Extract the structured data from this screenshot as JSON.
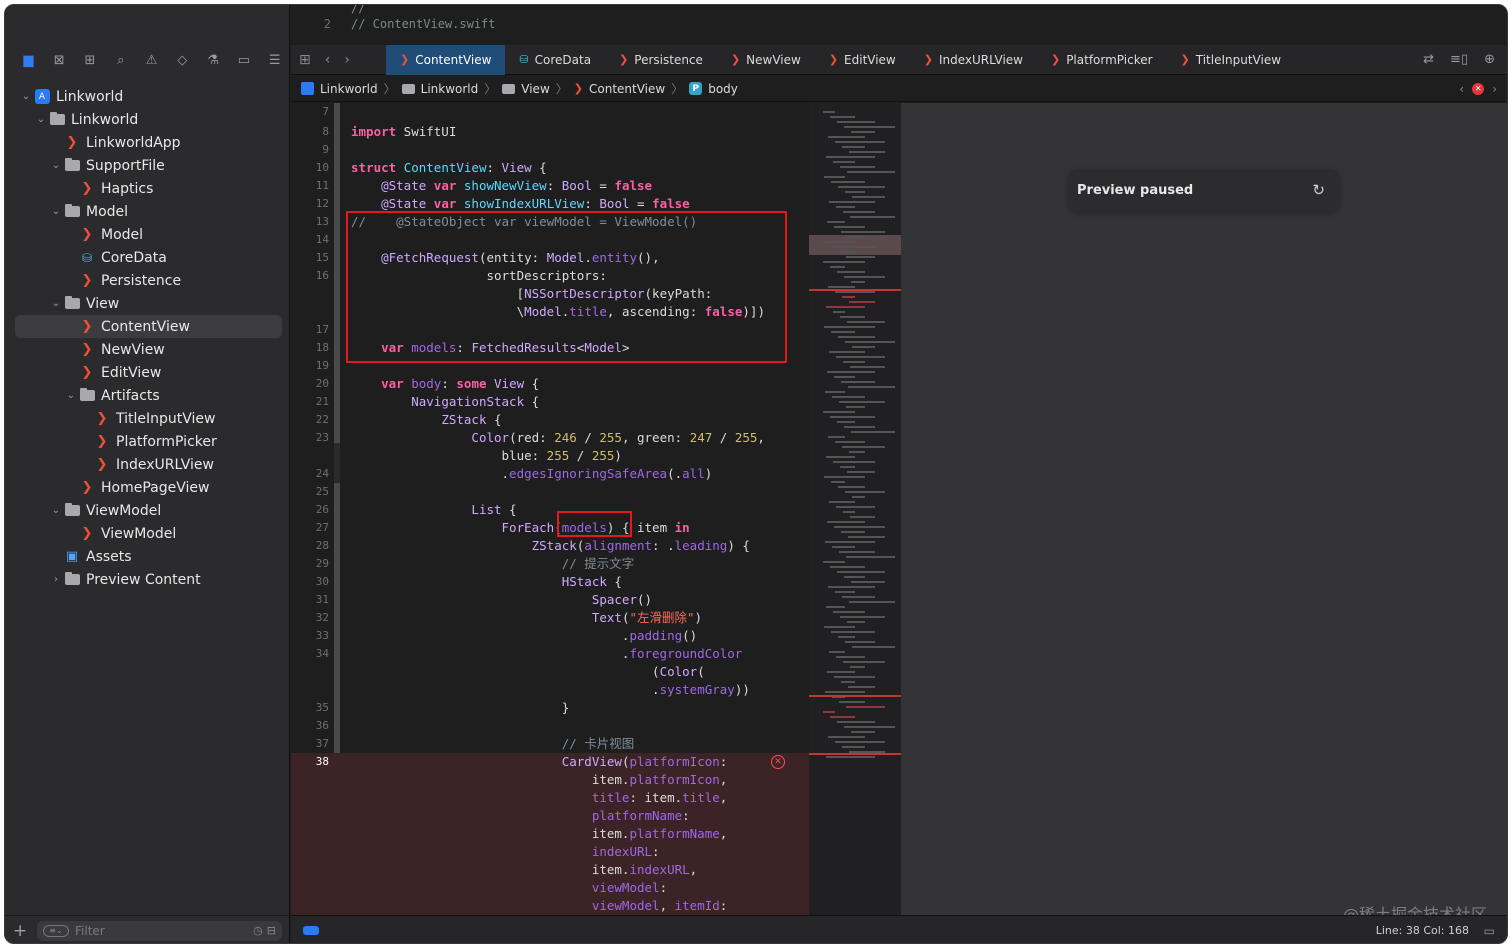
{
  "editor_top": {
    "lines": [
      {
        "n": "",
        "text": "//"
      },
      {
        "n": "2",
        "text": "//  ContentView.swift"
      }
    ]
  },
  "navigator": {
    "toolbar_icons": [
      "folder-icon",
      "x-square-icon",
      "hierarchy-icon",
      "search-icon",
      "warning-icon",
      "diamond-icon",
      "spray-icon",
      "tag-icon",
      "report-icon"
    ],
    "tree": [
      {
        "label": "Linkworld",
        "icon": "project-icon",
        "indent": 0,
        "chevron": "open"
      },
      {
        "label": "Linkworld",
        "icon": "folder-icon",
        "indent": 1,
        "chevron": "open"
      },
      {
        "label": "LinkworldApp",
        "icon": "swift-icon",
        "indent": 2,
        "chevron": ""
      },
      {
        "label": "SupportFile",
        "icon": "folder-icon",
        "indent": 2,
        "chevron": "open"
      },
      {
        "label": "Haptics",
        "icon": "swift-icon",
        "indent": 3,
        "chevron": ""
      },
      {
        "label": "Model",
        "icon": "folder-icon",
        "indent": 2,
        "chevron": "open"
      },
      {
        "label": "Model",
        "icon": "swift-icon",
        "indent": 3,
        "chevron": ""
      },
      {
        "label": "CoreData",
        "icon": "coredata-icon",
        "indent": 3,
        "chevron": ""
      },
      {
        "label": "Persistence",
        "icon": "swift-icon",
        "indent": 3,
        "chevron": ""
      },
      {
        "label": "View",
        "icon": "folder-icon",
        "indent": 2,
        "chevron": "open"
      },
      {
        "label": "ContentView",
        "icon": "swift-icon",
        "indent": 3,
        "chevron": "",
        "selected": true
      },
      {
        "label": "NewView",
        "icon": "swift-icon",
        "indent": 3,
        "chevron": ""
      },
      {
        "label": "EditView",
        "icon": "swift-icon",
        "indent": 3,
        "chevron": ""
      },
      {
        "label": "Artifacts",
        "icon": "folder-icon",
        "indent": 3,
        "chevron": "open"
      },
      {
        "label": "TitleInputView",
        "icon": "swift-icon",
        "indent": 4,
        "chevron": ""
      },
      {
        "label": "PlatformPicker",
        "icon": "swift-icon",
        "indent": 4,
        "chevron": ""
      },
      {
        "label": "IndexURLView",
        "icon": "swift-icon",
        "indent": 4,
        "chevron": ""
      },
      {
        "label": "HomePageView",
        "icon": "swift-icon",
        "indent": 3,
        "chevron": ""
      },
      {
        "label": "ViewModel",
        "icon": "folder-icon",
        "indent": 2,
        "chevron": "open"
      },
      {
        "label": "ViewModel",
        "icon": "swift-icon",
        "indent": 3,
        "chevron": ""
      },
      {
        "label": "Assets",
        "icon": "assets-icon",
        "indent": 2,
        "chevron": ""
      },
      {
        "label": "Preview Content",
        "icon": "folder-icon",
        "indent": 2,
        "chevron": "closed"
      }
    ],
    "filter_placeholder": "Filter"
  },
  "tabs": [
    {
      "label": "ContentView",
      "icon": "swift-icon",
      "active": true
    },
    {
      "label": "CoreData",
      "icon": "coredata-icon"
    },
    {
      "label": "Persistence",
      "icon": "swift-icon"
    },
    {
      "label": "NewView",
      "icon": "swift-icon"
    },
    {
      "label": "EditView",
      "icon": "swift-icon"
    },
    {
      "label": "IndexURLView",
      "icon": "swift-icon"
    },
    {
      "label": "PlatformPicker",
      "icon": "swift-icon"
    },
    {
      "label": "TitleInputView",
      "icon": "swift-icon"
    }
  ],
  "breadcrumb": [
    "Linkworld",
    "Linkworld",
    "View",
    "ContentView",
    "body"
  ],
  "preview": {
    "status": "Preview paused"
  },
  "status_bar": {
    "line_col": "Line: 38  Col: 168"
  },
  "watermark": "@稀土掘金技术社区",
  "colors": {
    "accent": "#2f7cf6",
    "error": "#e31a1c",
    "keyword": "#fc5fa3",
    "type": "#5dd8ff"
  }
}
